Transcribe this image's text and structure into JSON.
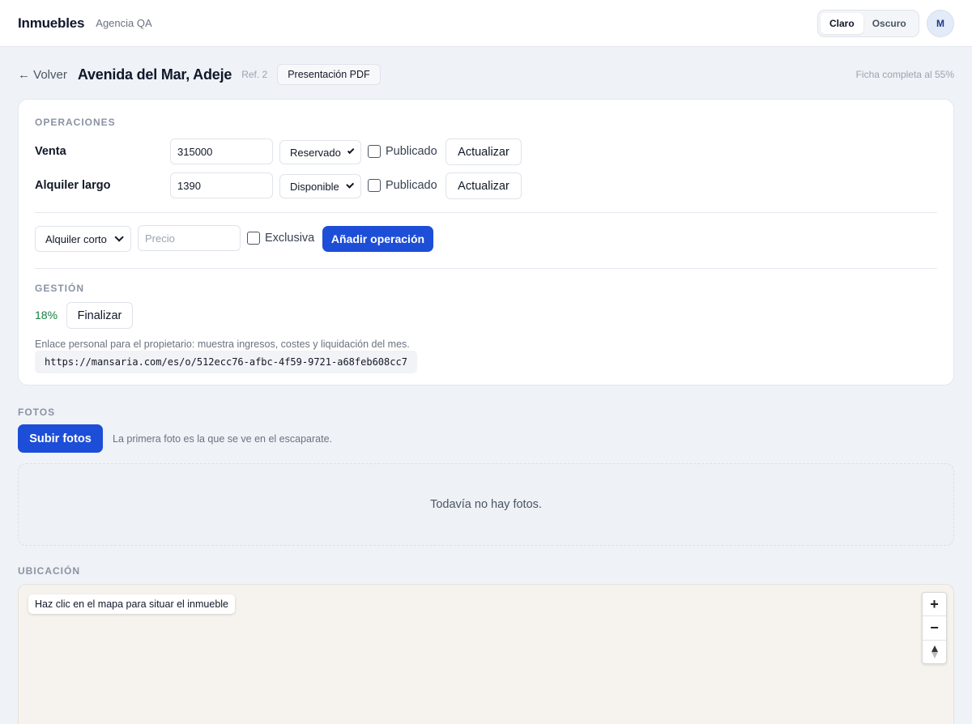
{
  "topbar": {
    "brand": "Inmuebles",
    "agency": "Agencia QA",
    "theme_options": [
      "Claro",
      "Oscuro"
    ],
    "theme_selected": "Claro",
    "avatar_initial": "M"
  },
  "header": {
    "back_label": "← Volver",
    "title": "Avenida del Mar, Adeje",
    "ref": "Ref. 2",
    "pdf_label": "Presentación PDF",
    "completion": "Ficha completa al 55%"
  },
  "operations": {
    "section_label": "OPERACIONES",
    "rows": [
      {
        "name": "Venta",
        "price": "315000",
        "status": "Reservado",
        "published_label": "Publicado",
        "published": false,
        "update_label": "Actualizar"
      },
      {
        "name": "Alquiler largo",
        "price": "1390",
        "status": "Disponible",
        "published_label": "Publicado",
        "published": false,
        "update_label": "Actualizar"
      }
    ],
    "new_op": {
      "type": "Alquiler corto",
      "price_placeholder": "Precio",
      "exclusive_label": "Exclusiva",
      "add_label": "Añadir operación"
    }
  },
  "management": {
    "section_label": "GESTIÓN",
    "progress": "18%",
    "finalize_label": "Finalizar",
    "owner_note": "Enlace personal para el propietario: muestra ingresos, costes y liquidación del mes.",
    "owner_url": "https://mansaria.com/es/o/512ecc76-afbc-4f59-9721-a68feb608cc7"
  },
  "photos": {
    "section_label": "FOTOS",
    "upload_label": "Subir fotos",
    "hint": "La primera foto es la que se ve en el escaparate.",
    "empty": "Todavía no hay fotos."
  },
  "location": {
    "section_label": "UBICACIÓN",
    "map_hint": "Haz clic en el mapa para situar el inmueble",
    "zoom_in": "+",
    "zoom_out": "−",
    "compass": "compass-icon"
  },
  "colors": {
    "primary": "#1d4ed8",
    "success": "#15803d",
    "background": "#eff2f7"
  }
}
